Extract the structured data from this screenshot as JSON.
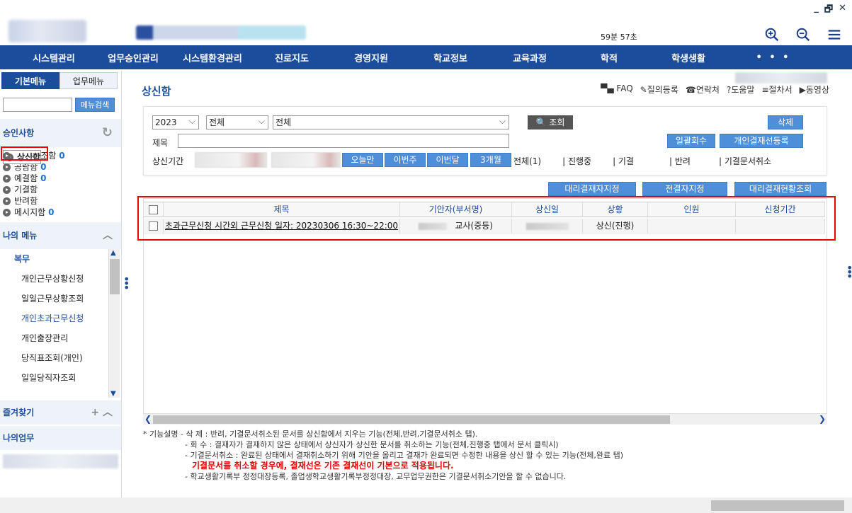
{
  "header": {
    "timer": "59분 57초",
    "window_controls": [
      "_",
      "🗗",
      "✕"
    ],
    "icons": [
      "zoom-in-icon",
      "zoom-out-icon",
      "hamburger-menu-icon"
    ]
  },
  "nav": {
    "items": [
      "시스템관리",
      "업무승인관리",
      "시스템환경관리",
      "진로지도",
      "경영지원",
      "학교정보",
      "교육과정",
      "학적",
      "학생생활"
    ],
    "more": "• • •"
  },
  "sidebar": {
    "tabs": [
      "기본메뉴",
      "업무메뉴"
    ],
    "search_button": "메뉴검색",
    "approval_title": "승인사항",
    "approval_items": [
      {
        "label": "상신함",
        "count": ""
      },
      {
        "label": "미결/협조함",
        "count": "0"
      },
      {
        "label": "공람함",
        "count": "0"
      },
      {
        "label": "예결함",
        "count": "0"
      },
      {
        "label": "기결함",
        "count": ""
      },
      {
        "label": "반려함",
        "count": ""
      },
      {
        "label": "메시지함",
        "count": "0"
      }
    ],
    "mymenu_title": "나의 메뉴",
    "mymenu_category": "복무",
    "mymenu_items": [
      "개인근무상황신청",
      "일일근무상황조회",
      "개인초과근무신청",
      "개인출장관리",
      "당직표조회(개인)",
      "일일당직자조회"
    ],
    "favorites_title": "즐겨찾기",
    "mywork_title": "나의업무"
  },
  "main": {
    "title": "상신함",
    "help_links": [
      "FAQ",
      "질의등록",
      "연락처",
      "도움말",
      "절차서",
      "동영상"
    ],
    "search": {
      "year": "2023",
      "select2": "전체",
      "select3": "전체",
      "search_button": "조회",
      "title_label": "제목",
      "period_label": "상신기간",
      "period_buttons": [
        "오늘만",
        "이번주",
        "이번달",
        "3개월"
      ],
      "status_tabs": [
        "전체(1)",
        "| 진행중",
        "| 기결",
        "| 반려",
        "| 기결문서취소"
      ],
      "delete_button": "삭제",
      "recall_button": "일괄회수",
      "personal_line_button": "개인결재선등록"
    },
    "action_buttons": [
      "대리결재자지정",
      "전결자지정",
      "대리결재현황조회"
    ],
    "grid": {
      "columns": [
        "제목",
        "기안자(부서명)",
        "상신일",
        "상황",
        "인원",
        "신청기간"
      ],
      "rows": [
        {
          "title": "초과근무신청 시간외 근무신청 일자: 20230306 16:30~22:00",
          "drafter_dept": "교사(중등)",
          "status": "상신(진행)",
          "people": "",
          "period": ""
        }
      ]
    },
    "notes": [
      "* 기능설명 - 삭 제 : 반려, 기결문서취소된 문서를 상신함에서 지우는 기능(전체,반려,기결문서취소 탭).",
      "- 회 수 : 결재자가 결재하지 않은 상태에서 상신자가 상신한 문서를 취소하는 기능(전체,진행중 탭에서 문서 클릭시)",
      "- 기결문서취소 : 완료된 상태에서 결재취소하기 위해 기안을 올리고 결재가 완료되면 수정한 내용을 상신 할 수 있는 기능(전체,완료 탭)",
      "기결문서를 취소할 경우에, 결재선은 기존 결재선이 기본으로 적용됩니다.",
      "- 학교생활기록부 정정대장등록, 졸업생학교생활기록부정정대장, 교무업무권한은 기결문서취소기안을 할 수 없습니다."
    ]
  },
  "colors": {
    "nav_bg": "#1c4c9c",
    "button_blue": "#4f8ed9",
    "warn_red": "#e00000"
  }
}
